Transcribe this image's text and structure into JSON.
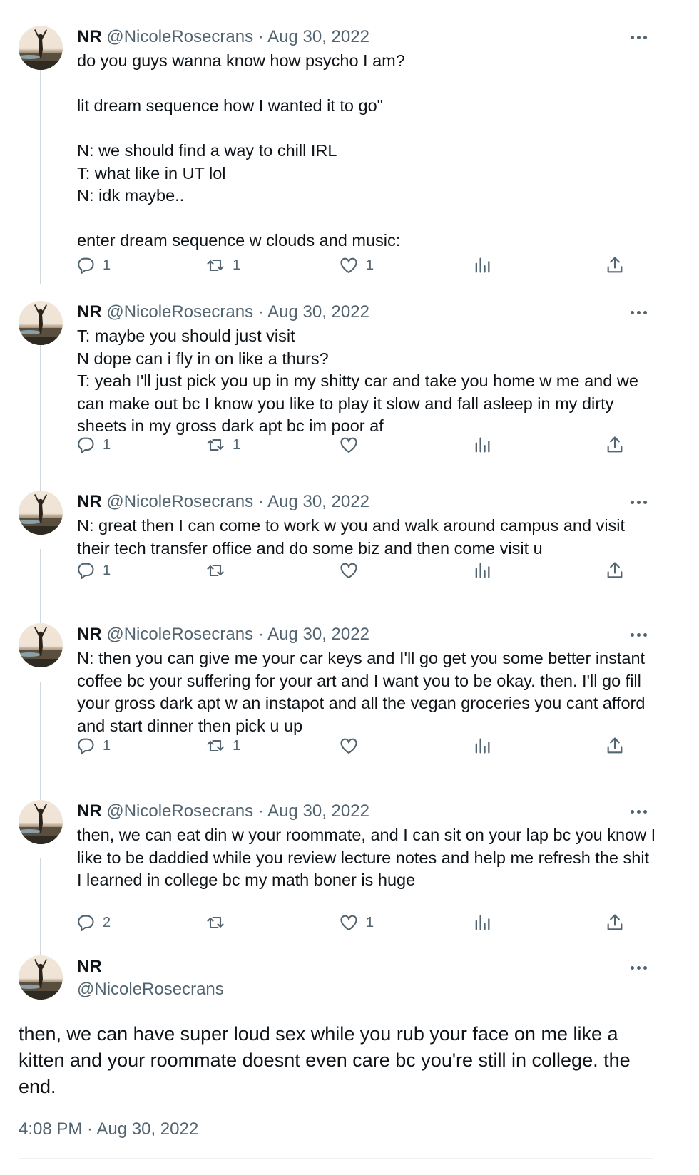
{
  "thread": [
    {
      "name": "NR",
      "handle": "@NicoleRosecrans",
      "date": "· Aug 30, 2022",
      "text": "do you guys wanna know how psycho I am?\n\nlit dream sequence how I wanted it to go\"\n\nN: we should find a way to chill IRL\nT: what like in UT lol\nN: idk maybe..\n\nenter dream sequence w clouds and music:",
      "replies": "1",
      "retweets": "1",
      "likes": "1"
    },
    {
      "name": "NR",
      "handle": "@NicoleRosecrans",
      "date": "· Aug 30, 2022",
      "text": "T: maybe you should just visit\nN dope can i fly in on like a thurs?\nT: yeah I'll just pick you up in my shitty car and take you home w me and we can make out bc I know you like to play it slow and fall asleep in my dirty sheets in my gross dark apt bc im poor af",
      "replies": "1",
      "retweets": "1",
      "likes": ""
    },
    {
      "name": "NR",
      "handle": "@NicoleRosecrans",
      "date": "· Aug 30, 2022",
      "text": "N: great then I can come to work w you and walk around campus and visit their tech transfer office and do some biz and then come visit u",
      "replies": "1",
      "retweets": "",
      "likes": ""
    },
    {
      "name": "NR",
      "handle": "@NicoleRosecrans",
      "date": "· Aug 30, 2022",
      "text": "N: then you can give me your car keys and I'll go get you some better instant coffee bc your suffering for your art and I want you to be okay. then. I'll go fill your gross dark apt w an instapot and all the vegan groceries you cant afford and start dinner then pick u up",
      "replies": "1",
      "retweets": "1",
      "likes": ""
    },
    {
      "name": "NR",
      "handle": "@NicoleRosecrans",
      "date": "· Aug 30, 2022",
      "text": "then, we can eat din w your roommate, and I can sit on your lap bc you know I like to be daddied while you review lecture notes and help me refresh the shit I learned in college bc my math boner is huge",
      "replies": "2",
      "retweets": "",
      "likes": "1"
    }
  ],
  "main": {
    "name": "NR",
    "handle": "@NicoleRosecrans",
    "text": "then, we can have super loud sex while you rub your face on me like a kitten and your roommate doesnt even care bc you're still in college. the end.",
    "timestamp": "4:08 PM · Aug 30, 2022"
  },
  "colors": {
    "text_primary": "#0f1419",
    "text_secondary": "#536471",
    "thread_line": "#cfd9de"
  },
  "icons": [
    "avatar-photo",
    "more-icon",
    "reply-icon",
    "retweet-icon",
    "like-icon",
    "views-icon",
    "share-icon"
  ]
}
